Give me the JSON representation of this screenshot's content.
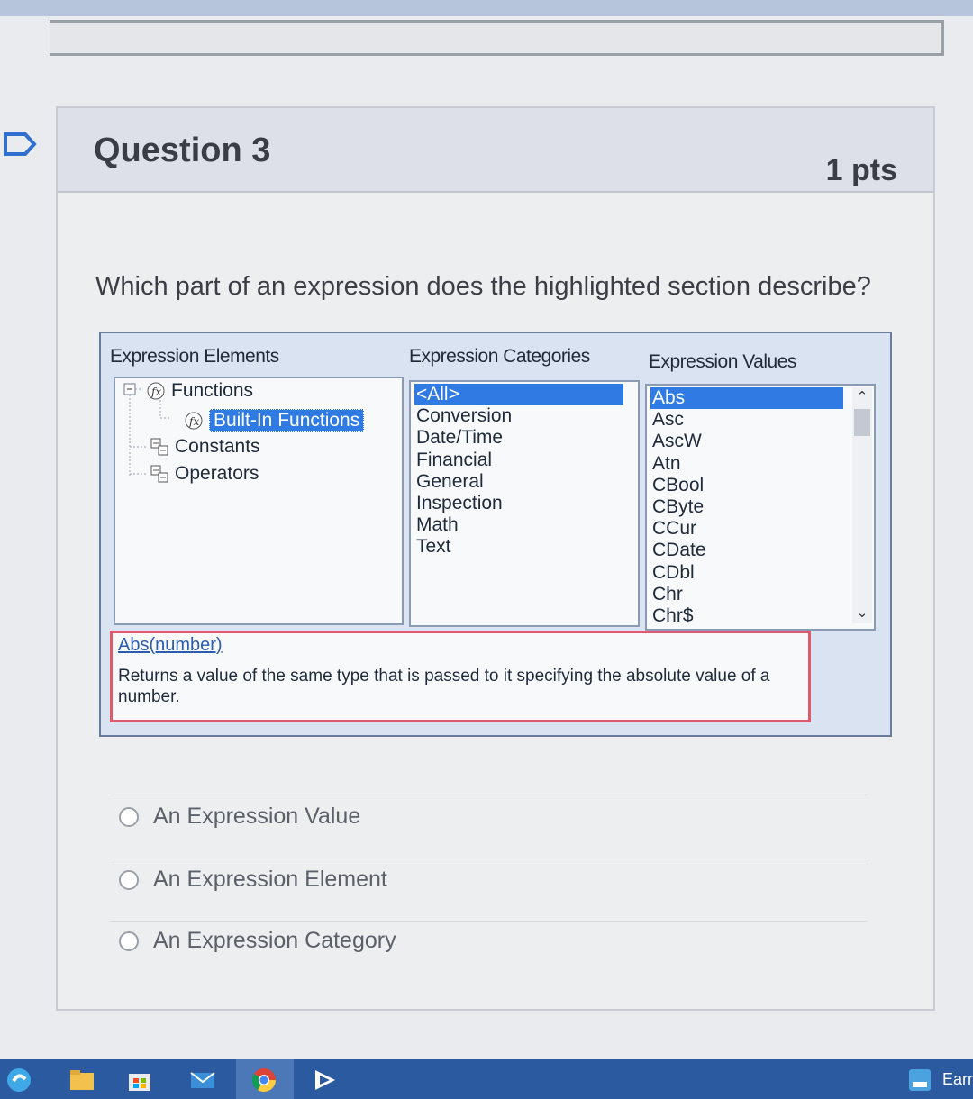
{
  "question": {
    "title": "Question 3",
    "points": "1 pts",
    "text": "Which part of an expression does the highlighted section describe?"
  },
  "dialog": {
    "elements_label": "Expression Elements",
    "categories_label": "Expression Categories",
    "values_label": "Expression Values",
    "tree": [
      {
        "label": "Functions",
        "icon": "function-icon"
      },
      {
        "label": "Built-In Functions",
        "icon": "function-icon",
        "selected": true
      },
      {
        "label": "Constants",
        "icon": "tree-node-icon"
      },
      {
        "label": "Operators",
        "icon": "tree-node-icon"
      }
    ],
    "categories": [
      "<All>",
      "Conversion",
      "Date/Time",
      "Financial",
      "General",
      "Inspection",
      "Math",
      "Text"
    ],
    "values": [
      "Abs",
      "Asc",
      "AscW",
      "Atn",
      "CBool",
      "CByte",
      "CCur",
      "CDate",
      "CDbl",
      "Chr",
      "Chr$"
    ],
    "description": {
      "syntax": "Abs(number)",
      "text": "Returns a value of the same type that is passed to it specifying the absolute value of a number."
    }
  },
  "answers": [
    "An Expression Value",
    "An Expression Element",
    "An Expression Category"
  ],
  "taskbar": {
    "tray_text": "Earn"
  },
  "colors": {
    "selection": "#2f7be3",
    "highlight_border": "#e05a6e",
    "taskbar": "#2c5aa0"
  }
}
